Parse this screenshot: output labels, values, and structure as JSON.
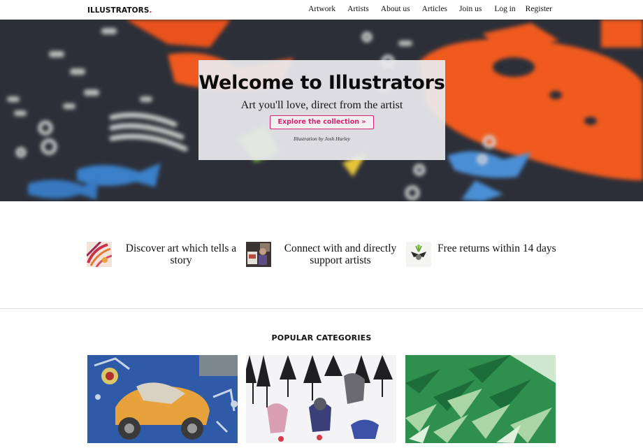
{
  "nav": {
    "logo": "ILLUSTRATORS",
    "logo_dot": ".",
    "links": [
      "Artwork",
      "Artists",
      "About us",
      "Articles",
      "Join us",
      "Log in",
      "Register"
    ]
  },
  "hero": {
    "title": "Welcome to Illustrators",
    "subtitle": "Art you'll love, direct from the artist",
    "button": "Explore the collection »",
    "credit": "Illustration by Josh Hurley"
  },
  "features": [
    {
      "text": "Discover art which tells a story",
      "icon": "floral-pattern-thumbnail"
    },
    {
      "text": "Connect with and directly support artists",
      "icon": "artist-photo-thumbnail"
    },
    {
      "text": "Free returns within 14 days",
      "icon": "plant-bat-thumbnail"
    }
  ],
  "categories": {
    "heading": "POPULAR CATEGORIES",
    "items": [
      {
        "icon": "robot-car-illustration"
      },
      {
        "icon": "winter-animals-illustration"
      },
      {
        "icon": "green-leaves-illustration"
      }
    ]
  },
  "colors": {
    "accent": "#d1236f",
    "hero_dark": "#2b2e36",
    "orange": "#f05a1e"
  }
}
